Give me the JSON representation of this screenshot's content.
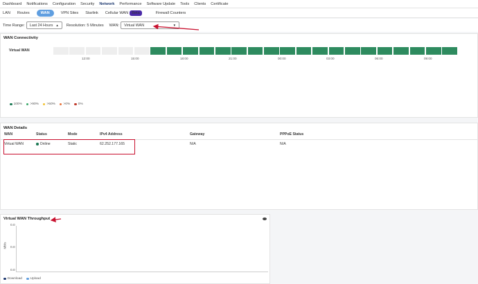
{
  "top_nav": [
    {
      "label": "Dashboard",
      "active": false
    },
    {
      "label": "Notifications",
      "active": false
    },
    {
      "label": "Configuration",
      "active": false
    },
    {
      "label": "Security",
      "active": false
    },
    {
      "label": "Network",
      "active": true
    },
    {
      "label": "Performance",
      "active": false
    },
    {
      "label": "Software Update",
      "active": false
    },
    {
      "label": "Tools",
      "active": false
    },
    {
      "label": "Clients",
      "active": false
    },
    {
      "label": "Certificate",
      "active": false
    }
  ],
  "sub_nav": [
    {
      "label": "LAN",
      "active": false
    },
    {
      "label": "Routes",
      "active": false
    },
    {
      "label": "WAN",
      "active": true
    },
    {
      "label": "VPN Sites",
      "active": false
    },
    {
      "label": "Starlink",
      "active": false
    },
    {
      "label": "Cellular WAN",
      "active": false,
      "badge": "Beta"
    },
    {
      "label": "Firewall Counters",
      "active": false
    }
  ],
  "toolbar": {
    "time_range_label": "Time Range:",
    "time_range_value": "Last 24 Hours",
    "resolution_label": "Resolution: 5 Minutes",
    "wan_label": "WAN:",
    "wan_value": "Virtual WAN"
  },
  "connectivity": {
    "title": "WAN Connectivity",
    "row_label": "Virtual WAN",
    "cells": [
      "nodata",
      "nodata",
      "nodata",
      "nodata",
      "nodata",
      "nodata",
      "up",
      "up",
      "up",
      "up",
      "up",
      "up",
      "up",
      "up",
      "up",
      "up",
      "up",
      "up",
      "up",
      "up",
      "up",
      "up",
      "up",
      "up",
      "up"
    ],
    "axis_ticks": [
      "12:00",
      "15:00",
      "18:00",
      "21:00",
      "00:00",
      "03:00",
      "06:00",
      "09:00"
    ],
    "legend": [
      {
        "label": "100%",
        "color": "#1e7a55"
      },
      {
        "label": ">90%",
        "color": "#3aa86a"
      },
      {
        "label": ">50%",
        "color": "#f1c232"
      },
      {
        "label": ">0%",
        "color": "#e8743b"
      },
      {
        "label": "0%",
        "color": "#c0392b"
      }
    ],
    "colors": {
      "up": "#2e8b5f",
      "nodata": "#eeeeee"
    }
  },
  "wan_details": {
    "title": "WAN Details",
    "headers": [
      "WAN",
      "Status",
      "Mode",
      "IPv4 Address",
      "Gateway",
      "PPPoE Status"
    ],
    "rows": [
      {
        "wan": "Virtual WAN",
        "status": "Online",
        "mode": "Static",
        "ipv4": "62.252.177.165",
        "gateway": "N/A",
        "pppoe": "N/A"
      }
    ],
    "status_color": "#1e7a55"
  },
  "throughput": {
    "title": "Virtual WAN Throughput",
    "y_axis_label": "Mb/s",
    "y_ticks": [
      "0.0",
      "0.0",
      "0.0"
    ],
    "legend": [
      {
        "label": "Download",
        "color": "#1f3a70"
      },
      {
        "label": "Upload",
        "color": "#5f9ee0"
      }
    ]
  },
  "annotation_color": "#c8102e"
}
